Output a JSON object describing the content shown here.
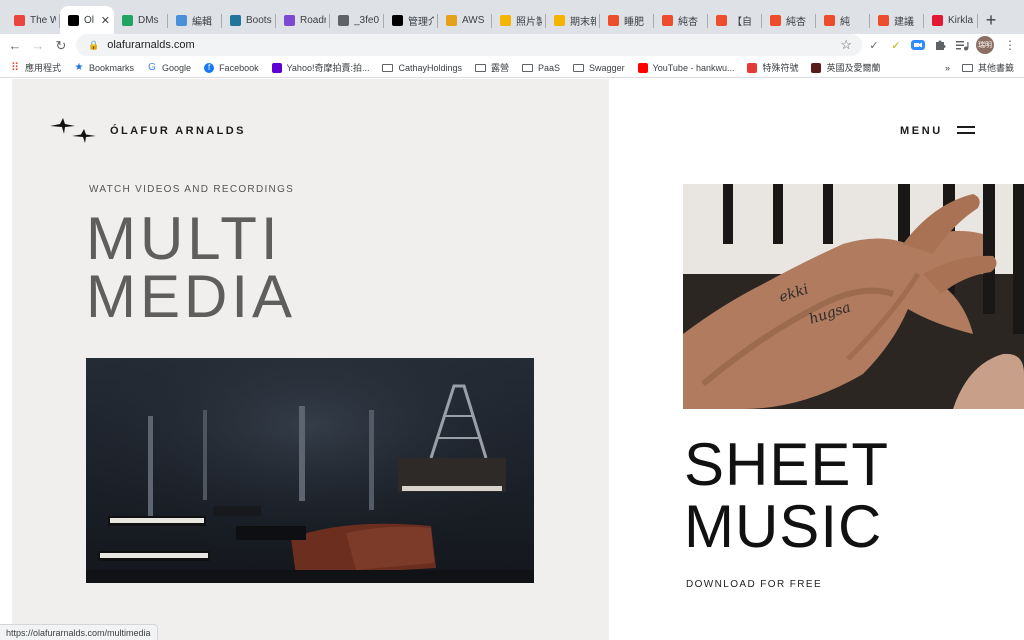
{
  "browser": {
    "tabs": [
      {
        "title": "The W",
        "icon": "lf-icon",
        "color": "#e8453c"
      },
      {
        "title": "Ól",
        "icon": "bird-icon",
        "color": "#000000",
        "active": true
      },
      {
        "title": "DMs",
        "icon": "drive-icon",
        "color": "#1fa463"
      },
      {
        "title": "編輯",
        "icon": "site-icon",
        "color": "#4a90d9"
      },
      {
        "title": "Boots",
        "icon": "wordpress-icon",
        "color": "#21759b"
      },
      {
        "title": "Roadr",
        "icon": "roadmap-icon",
        "color": "#7b4ad1"
      },
      {
        "title": "_3fe0",
        "icon": "globe-icon",
        "color": "#5f6368"
      },
      {
        "title": "管理介",
        "icon": "wix-icon",
        "color": "#000000"
      },
      {
        "title": "AWS",
        "icon": "aws-icon",
        "color": "#e3a21a"
      },
      {
        "title": "照片製",
        "icon": "slides-icon",
        "color": "#f4b400"
      },
      {
        "title": "期末報",
        "icon": "slides-icon",
        "color": "#f4b400"
      },
      {
        "title": "睡肥",
        "icon": "shopee-icon",
        "color": "#ee4d2d"
      },
      {
        "title": "純杏",
        "icon": "shopee-icon",
        "color": "#ee4d2d"
      },
      {
        "title": "【自",
        "icon": "shopee-icon",
        "color": "#ee4d2d"
      },
      {
        "title": "純杏",
        "icon": "shopee-icon",
        "color": "#ee4d2d"
      },
      {
        "title": "純",
        "icon": "shopee-icon",
        "color": "#ee4d2d"
      },
      {
        "title": "建議",
        "icon": "shopee-icon",
        "color": "#ee4d2d"
      },
      {
        "title": "Kirkla",
        "icon": "costco-icon",
        "color": "#e31837"
      }
    ],
    "close_glyph": "✕",
    "new_tab_glyph": "+",
    "url": "olafurarnalds.com",
    "bookmarks": [
      {
        "label": "應用程式",
        "icon": "apps-icon"
      },
      {
        "label": "Bookmarks",
        "icon": "star-icon"
      },
      {
        "label": "Google",
        "icon": "google-icon"
      },
      {
        "label": "Facebook",
        "icon": "facebook-icon"
      },
      {
        "label": "Yahoo!奇摩拍賣:拍...",
        "icon": "yahoo-icon"
      },
      {
        "label": "CathayHoldings",
        "icon": "folder-icon"
      },
      {
        "label": "露營",
        "icon": "folder-icon"
      },
      {
        "label": "PaaS",
        "icon": "folder-icon"
      },
      {
        "label": "Swagger",
        "icon": "folder-icon"
      },
      {
        "label": "YouTube - hankwu...",
        "icon": "youtube-icon"
      },
      {
        "label": "特殊符號",
        "icon": "bolt-icon"
      },
      {
        "label": "英國及愛爾蘭",
        "icon": "flag-icon"
      }
    ],
    "bookmarks_more": "»",
    "other_bookmarks": "其他書籤",
    "profile_initials": "瑞明",
    "status_url": "https://olafurarnalds.com/multimedia"
  },
  "site": {
    "logo_text": "ÓLAFUR ARNALDS",
    "menu_label": "MENU",
    "multimedia": {
      "subtitle": "WATCH VIDEOS AND RECORDINGS",
      "title_line1": "MULTI",
      "title_line2": "MEDIA"
    },
    "sheet_music": {
      "title_line1": "SHEET",
      "title_line2": "MUSIC",
      "subtitle": "DOWNLOAD FOR FREE"
    }
  }
}
